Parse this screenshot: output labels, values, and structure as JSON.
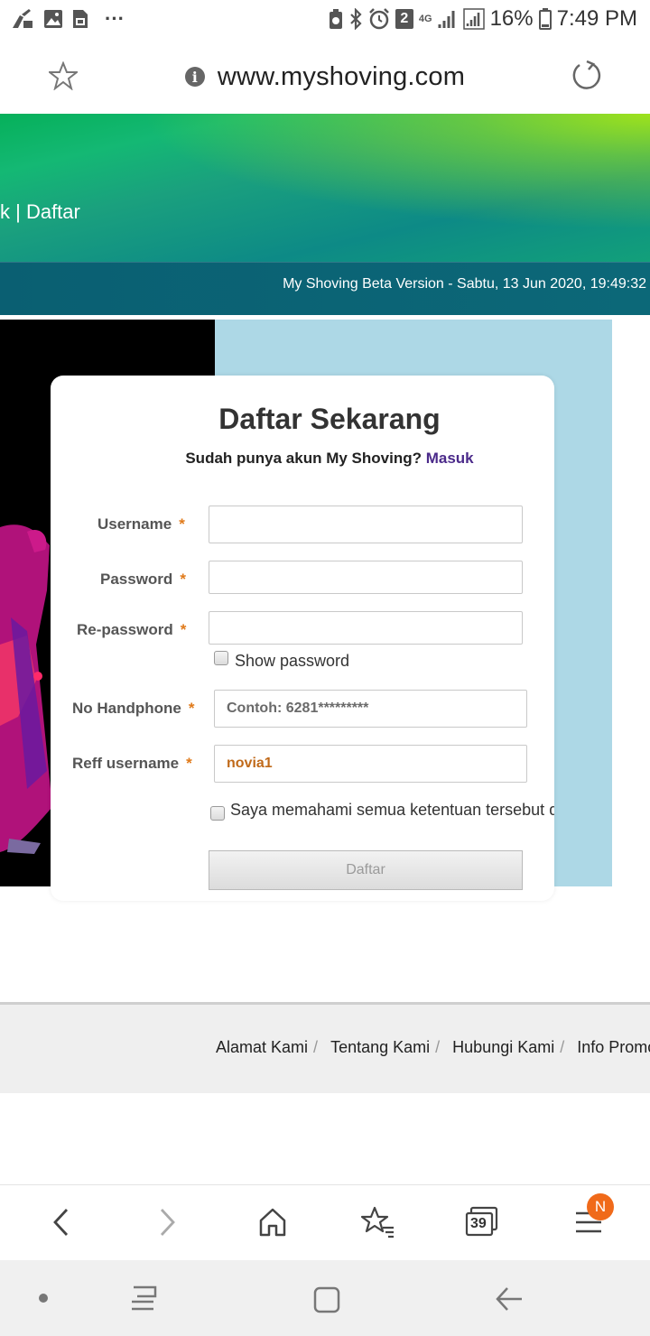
{
  "status_bar": {
    "battery": "16%",
    "time": "7:49 PM",
    "notification_count": "2",
    "network": "4G",
    "more": "···"
  },
  "browser": {
    "url": "www.myshoving.com",
    "tabs_count": "39",
    "menu_badge": "N"
  },
  "header": {
    "nav_text": "k | Daftar",
    "banner": "My Shoving Beta Version - Sabtu, 13 Jun 2020, 19:49:32"
  },
  "form": {
    "title": "Daftar Sekarang",
    "subtitle": "Sudah punya akun My Shoving?",
    "login_link": "Masuk",
    "required_mark": "*",
    "username_label": "Username",
    "password_label": "Password",
    "repassword_label": "Re-password",
    "show_password_label": "Show password",
    "phone_label": "No Handphone",
    "phone_placeholder": "Contoh: 6281*********",
    "reff_label": "Reff username",
    "reff_value": "novia1",
    "terms_label": "Saya memahami semua ketentuan tersebut di",
    "submit_label": "Daftar"
  },
  "footer": {
    "links": [
      "Alamat Kami",
      "Tentang Kami",
      "Hubungi Kami",
      "Info Promo"
    ],
    "separator": "/"
  }
}
